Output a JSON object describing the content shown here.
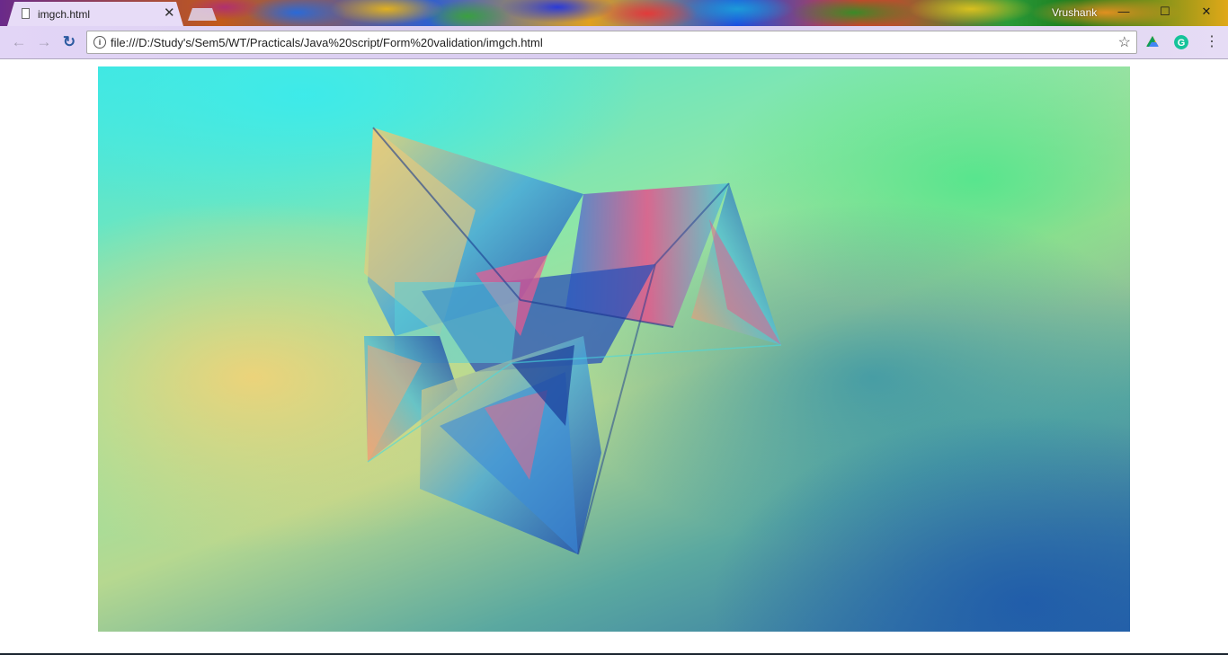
{
  "browser": {
    "tab": {
      "title": "imgch.html",
      "close_glyph": "✕",
      "icon": "document-icon"
    },
    "profile_name": "Vrushank",
    "window_controls": {
      "minimize": "—",
      "maximize": "☐",
      "close": "✕"
    },
    "toolbar": {
      "back_glyph": "←",
      "forward_glyph": "→",
      "reload_glyph": "↻",
      "address": "file:///D:/Study's/Sem5/WT/Practicals/Java%20script/Form%20validation/imgch.html",
      "info_glyph": "i",
      "star_glyph": "☆",
      "menu_glyph": "⋮"
    },
    "extensions": [
      "drive-extension-icon",
      "grammarly-extension-icon"
    ]
  },
  "page": {
    "image": "abstract-geometric-artwork"
  },
  "colors": {
    "tab_bg": "#e7dcf7",
    "toolbar_bg": "#d8ccef",
    "grammarly": "#15c39a"
  }
}
